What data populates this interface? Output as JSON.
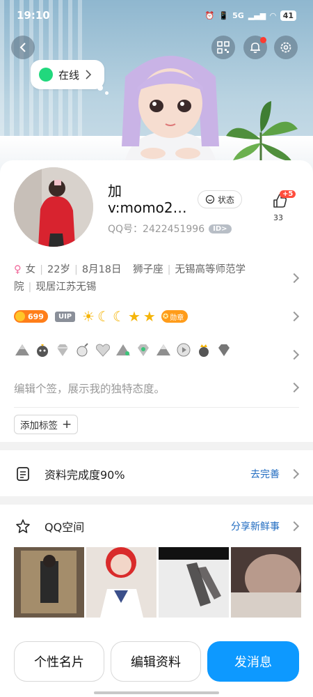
{
  "status_bar": {
    "time": "19:10",
    "network": "5G",
    "battery": "41"
  },
  "header": {
    "online_label": "在线"
  },
  "profile": {
    "nickname_line1": "加",
    "nickname_line2": "v:momo2…",
    "qq_label": "QQ号：2422451996",
    "id_badge": "ID>",
    "state_button": "状态",
    "like_badge": "+5",
    "like_count": "33"
  },
  "info": {
    "gender": "女",
    "age": "22岁",
    "birthday": "8月18日",
    "zodiac": "狮子座",
    "school_line1": "无锡高等师范学",
    "school_line2": "院",
    "residence": "现居江苏无锡"
  },
  "badges": {
    "coin_value": "699",
    "vip_label": "UIP",
    "medal_label": "勋章"
  },
  "signature": {
    "placeholder": "编辑个签，展示我的独特态度。"
  },
  "tags": {
    "add_label": "添加标签"
  },
  "completeness": {
    "title": "资料完成度90%",
    "action": "去完善"
  },
  "qzone": {
    "title": "QQ空间",
    "action": "分享新鲜事"
  },
  "actions": {
    "card_label": "个性名片",
    "edit_label": "编辑资料",
    "message_label": "发消息"
  },
  "colors": {
    "accent": "#0d99ff",
    "online": "#21d87d",
    "link": "#1f6bc0",
    "alert": "#ff3b30"
  }
}
